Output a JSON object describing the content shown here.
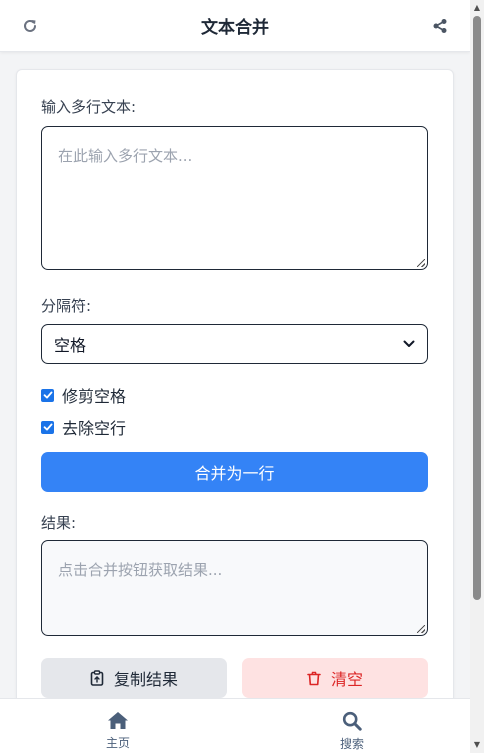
{
  "header": {
    "title": "文本合并",
    "refresh_icon": "refresh-icon",
    "share_icon": "share-icon"
  },
  "form": {
    "input_label": "输入多行文本:",
    "input_placeholder": "在此输入多行文本...",
    "separator_label": "分隔符:",
    "separator_value": "空格",
    "trim_label": "修剪空格",
    "trim_checked": true,
    "remove_empty_label": "去除空行",
    "remove_empty_checked": true,
    "merge_button": "合并为一行",
    "result_label": "结果:",
    "result_placeholder": "点击合并按钮获取结果...",
    "copy_button": "复制结果",
    "clear_button": "清空"
  },
  "nav": {
    "home_label": "主页",
    "search_label": "搜索"
  },
  "colors": {
    "primary": "#3483f6",
    "danger": "#dc2626",
    "danger_bg": "#fee2e2",
    "nav": "#4b5f7a"
  }
}
